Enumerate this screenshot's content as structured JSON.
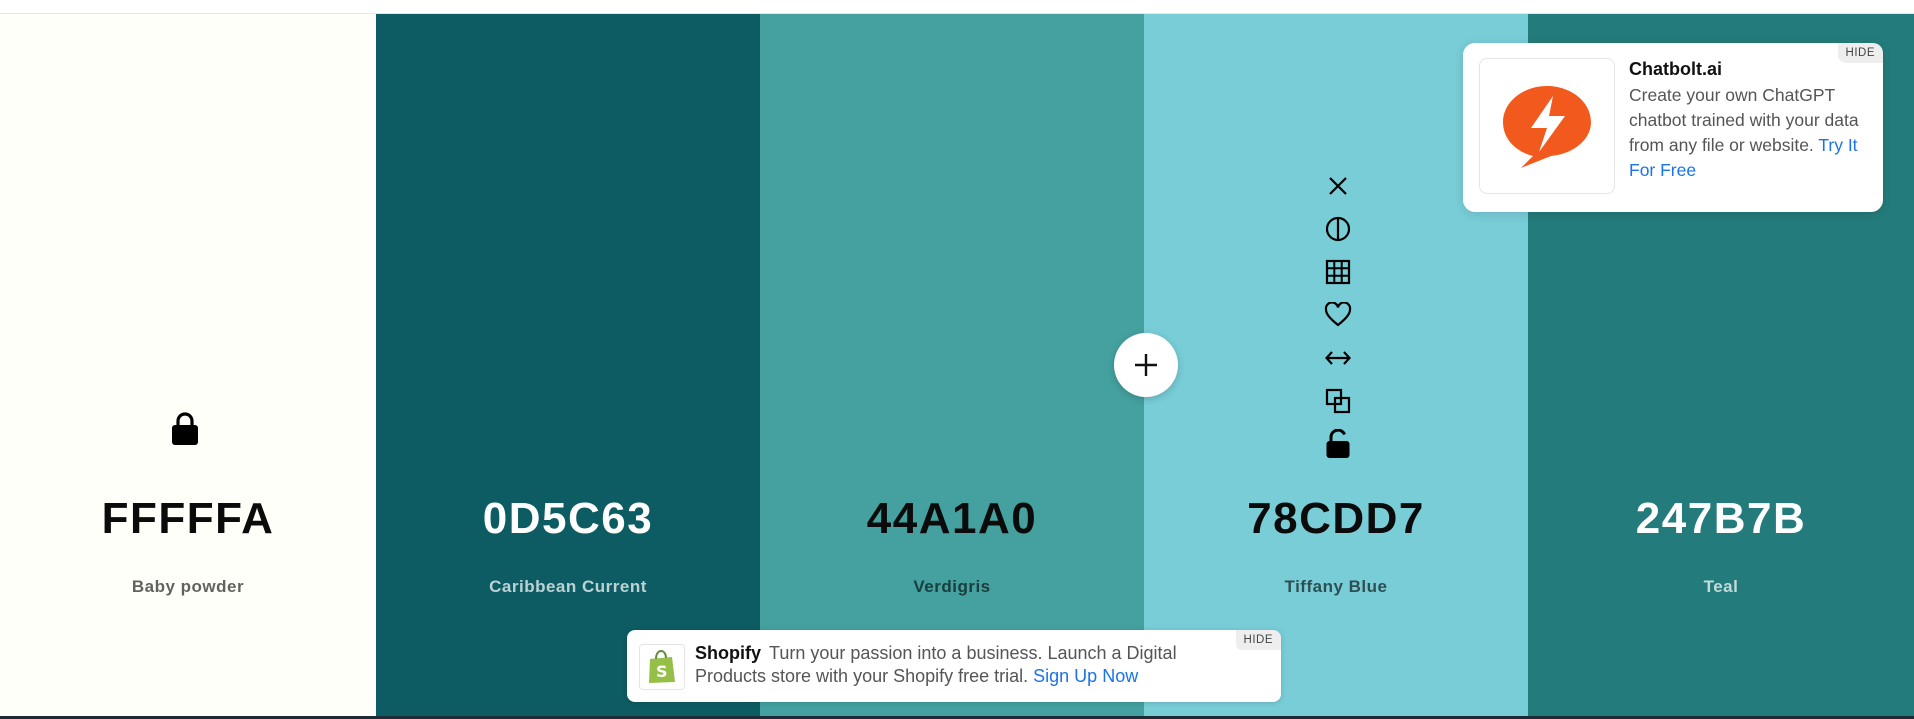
{
  "palette": [
    {
      "hex": "FFFFFA",
      "name": "Baby powder",
      "color": "#FFFFFA",
      "tone": "light"
    },
    {
      "hex": "0D5C63",
      "name": "Caribbean Current",
      "color": "#0D5C63",
      "tone": "dark"
    },
    {
      "hex": "44A1A0",
      "name": "Verdigris",
      "color": "#44A1A0",
      "tone": "light"
    },
    {
      "hex": "78CDD7",
      "name": "Tiffany Blue",
      "color": "#78CDD7",
      "tone": "light"
    },
    {
      "hex": "247B7B",
      "name": "Teal",
      "color": "#247B7B",
      "tone": "dark"
    }
  ],
  "swatch_toolbar": {
    "icons": [
      "close-icon",
      "contrast-icon",
      "shades-grid-icon",
      "heart-icon",
      "drag-arrows-icon",
      "copy-icon",
      "unlock-icon"
    ]
  },
  "locked_icon": "lock-icon",
  "add_button_icon": "plus-icon",
  "sponsor_card": {
    "title": "Chatbolt.ai",
    "text": "Create your own ChatGPT chatbot trained with your data from any file or website.",
    "link": "Try It For Free",
    "hide": "HIDE",
    "accent": "#F25A1D"
  },
  "bottom_ad": {
    "brand": "Shopify",
    "text": "Turn your passion into a business. Launch a Digital Products store with your Shopify free trial.",
    "link": "Sign Up Now",
    "hide": "HIDE",
    "accent": "#95BF47"
  }
}
